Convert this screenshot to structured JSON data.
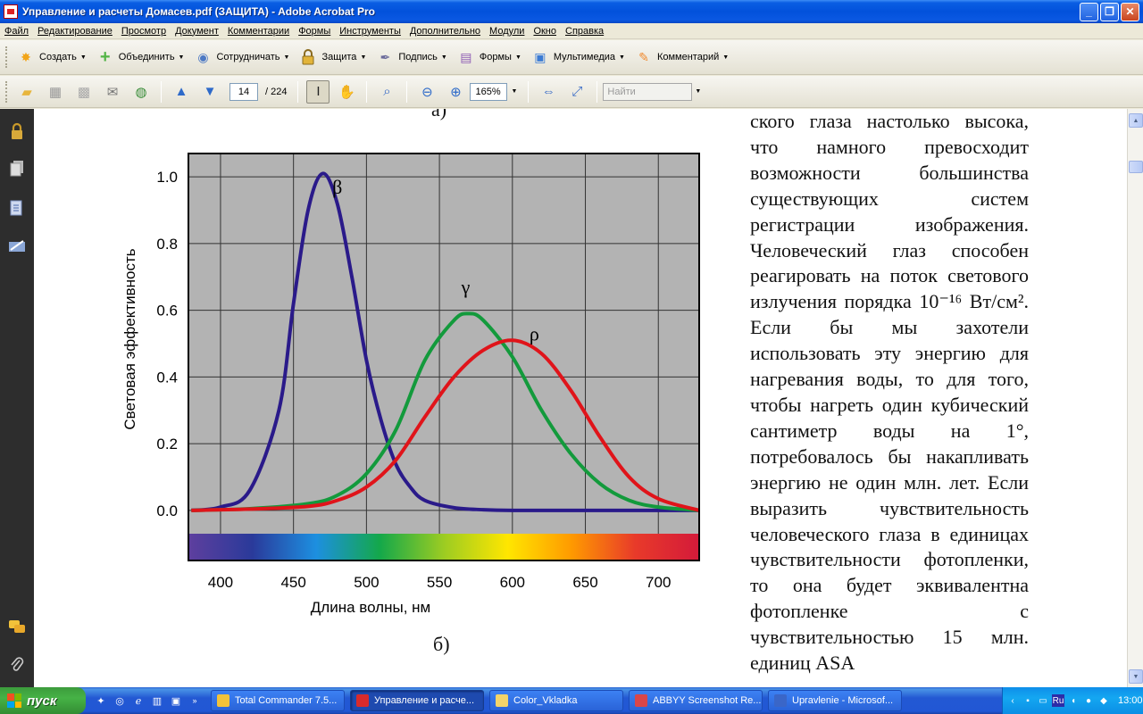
{
  "window": {
    "title": "Управление и расчеты Домасев.pdf (ЗАЩИТА) - Adobe Acrobat Pro",
    "buttons": [
      "_",
      "❐",
      "✕"
    ]
  },
  "menubar": [
    "Файл",
    "Редактирование",
    "Просмотр",
    "Документ",
    "Комментарии",
    "Формы",
    "Инструменты",
    "Дополнительно",
    "Модули",
    "Окно",
    "Справка"
  ],
  "toolbar1": {
    "items": [
      {
        "label": "Создать",
        "icon": "create-icon",
        "color": "#f2a519"
      },
      {
        "label": "Объединить",
        "icon": "combine-icon",
        "color": "#53b446"
      },
      {
        "label": "Сотрудничать",
        "icon": "collaborate-icon",
        "color": "#4d79c4"
      },
      {
        "label": "Защита",
        "icon": "lock-icon",
        "color": "#caa24a"
      },
      {
        "label": "Подпись",
        "icon": "pen-icon",
        "color": "#6a6a9a"
      },
      {
        "label": "Формы",
        "icon": "forms-icon",
        "color": "#8e5cb5"
      },
      {
        "label": "Мультимедиа",
        "icon": "multimedia-icon",
        "color": "#3b7bd4"
      },
      {
        "label": "Комментарий",
        "icon": "comment-icon",
        "color": "#f08a2f"
      }
    ]
  },
  "toolbar2": {
    "page_current": "14",
    "page_total": "/ 224",
    "zoom": "165%",
    "find_placeholder": "Найти"
  },
  "document": {
    "top_caption": "а)",
    "bottom_caption": "б)",
    "body_text": "ского глаза настолько высока, что намного превосходит возможности большинства существующих систем регистрации изображения. Человеческий глаз способен реагировать на поток светового излучения порядка 10⁻¹⁶ Вт/см². Если бы мы захотели использовать эту энергию для нагревания воды, то для того, чтобы нагреть один кубический сантиметр воды на 1°, потребовалось бы накапливать энергию не один млн. лет. Если выразить чувствительность человеческого глаза в единицах чувствительности фотопленки, то она будет эквивалентна фотопленке с чувствительностью 15 млн. единиц ASA"
  },
  "chart_data": {
    "type": "line",
    "xlabel": "Длина волны, нм",
    "ylabel": "Световая эффективность",
    "xlim": [
      378,
      728
    ],
    "ylim": [
      -0.07,
      1.07
    ],
    "xticks": [
      400,
      450,
      500,
      550,
      600,
      650,
      700
    ],
    "yticks": [
      "0.0",
      "0.2",
      "0.4",
      "0.6",
      "0.8",
      "1.0"
    ],
    "grid": true,
    "background": "#b3b3b3",
    "series": [
      {
        "name": "β",
        "color": "#2a1a8a",
        "x": [
          380,
          400,
          420,
          440,
          450,
          460,
          470,
          480,
          490,
          500,
          510,
          520,
          530,
          540,
          560,
          580,
          600,
          650,
          700,
          728
        ],
        "y": [
          0.0,
          0.01,
          0.06,
          0.3,
          0.62,
          0.9,
          1.01,
          0.92,
          0.7,
          0.45,
          0.27,
          0.14,
          0.07,
          0.03,
          0.008,
          0.002,
          0.0,
          0.0,
          0.0,
          0.0
        ]
      },
      {
        "name": "γ",
        "color": "#139a3c",
        "x": [
          380,
          420,
          460,
          480,
          500,
          520,
          540,
          560,
          570,
          580,
          600,
          620,
          640,
          660,
          680,
          700,
          728
        ],
        "y": [
          0.0,
          0.005,
          0.02,
          0.045,
          0.11,
          0.24,
          0.45,
          0.57,
          0.59,
          0.57,
          0.46,
          0.3,
          0.17,
          0.08,
          0.03,
          0.01,
          0.0
        ]
      },
      {
        "name": "ρ",
        "color": "#e0141a",
        "x": [
          380,
          420,
          460,
          480,
          500,
          520,
          540,
          560,
          580,
          600,
          620,
          640,
          660,
          680,
          700,
          728
        ],
        "y": [
          0.0,
          0.004,
          0.012,
          0.03,
          0.07,
          0.15,
          0.28,
          0.4,
          0.48,
          0.51,
          0.47,
          0.36,
          0.22,
          0.1,
          0.035,
          0.0
        ]
      }
    ],
    "series_labels": [
      {
        "text": "β",
        "x": 480,
        "y": 0.95
      },
      {
        "text": "γ",
        "x": 568,
        "y": 0.65
      },
      {
        "text": "ρ",
        "x": 615,
        "y": 0.51
      }
    ],
    "spectrum_stops": [
      "#5e3f9e",
      "#2a3a9a",
      "#1d8fe0",
      "#14a84a",
      "#9ccc22",
      "#ffe600",
      "#ff9a00",
      "#e83a2a",
      "#d41a3a"
    ]
  },
  "leftpanel_icons": [
    "lock-icon",
    "pages-icon",
    "attachments-icon",
    "signatures-icon",
    "comments-icon",
    "paperclip-icon"
  ],
  "taskbar": {
    "start_label": "пуск",
    "tasks": [
      {
        "label": "Total Commander 7.5...",
        "active": false,
        "color": "#f2c23a"
      },
      {
        "label": "Управление и расче...",
        "active": true,
        "color": "#d92b2b"
      },
      {
        "label": "Color_Vkladka",
        "active": false,
        "color": "#f3d46a"
      },
      {
        "label": "ABBYY Screenshot Re...",
        "active": false,
        "color": "#d9464a"
      },
      {
        "label": "Upravlenie - Microsof...",
        "active": false,
        "color": "#3a66c8"
      }
    ],
    "lang": "Ru",
    "clock": "13:00"
  }
}
